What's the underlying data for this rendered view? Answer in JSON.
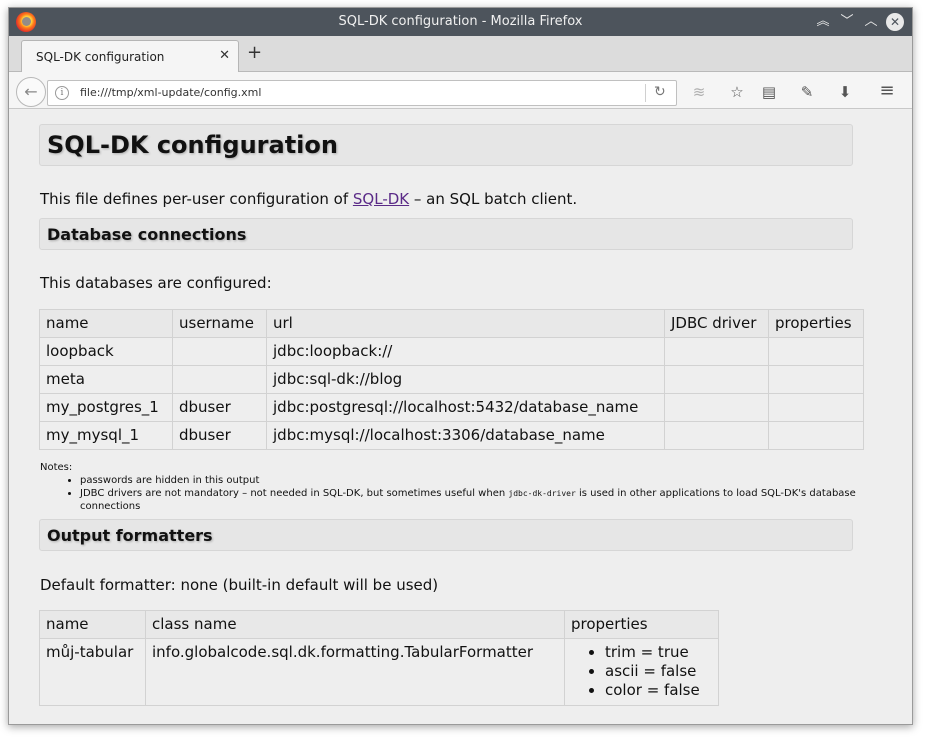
{
  "window": {
    "title": "SQL-DK configuration - Mozilla Firefox"
  },
  "tabs": [
    {
      "label": "SQL-DK configuration"
    }
  ],
  "navbar": {
    "url": "file:///tmp/xml-update/config.xml"
  },
  "page": {
    "title": "SQL-DK configuration",
    "intro_before": "This file defines per-user configuration of ",
    "intro_link": "SQL-DK",
    "intro_after": " – an SQL batch client.",
    "db_heading": "Database connections",
    "db_intro": "This databases are configured:",
    "db_columns": [
      "name",
      "username",
      "url",
      "JDBC driver",
      "properties"
    ],
    "db_rows": [
      [
        "loopback",
        "",
        "jdbc:loopback://",
        "",
        ""
      ],
      [
        "meta",
        "",
        "jdbc:sql-dk://blog",
        "",
        ""
      ],
      [
        "my_postgres_1",
        "dbuser",
        "jdbc:postgresql://localhost:5432/database_name",
        "",
        ""
      ],
      [
        "my_mysql_1",
        "dbuser",
        "jdbc:mysql://localhost:3306/database_name",
        "",
        ""
      ]
    ],
    "notes_label": "Notes:",
    "note_1": "passwords are hidden in this output",
    "note_2_before": "JDBC drivers are not mandatory – not needed in SQL-DK, but sometimes useful when ",
    "note_2_code": "jdbc-dk-driver",
    "note_2_after": " is used in other applications to load SQL-DK's database connections",
    "out_heading": "Output formatters",
    "default_formatter": "Default formatter: none (built-in default will be used)",
    "fmt_columns": [
      "name",
      "class name",
      "properties"
    ],
    "fmt_rows": [
      {
        "name": "můj-tabular",
        "class_name": "info.globalcode.sql.dk.formatting.TabularFormatter",
        "properties": [
          "trim = true",
          "ascii = false",
          "color = false"
        ]
      }
    ]
  }
}
